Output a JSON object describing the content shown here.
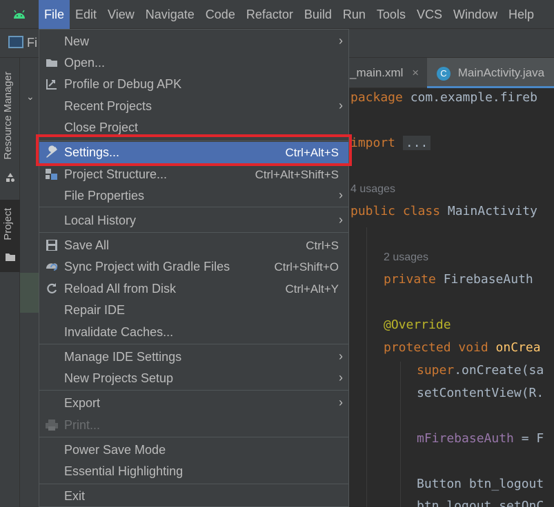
{
  "menubar": {
    "items": [
      "File",
      "Edit",
      "View",
      "Navigate",
      "Code",
      "Refactor",
      "Build",
      "Run",
      "Tools",
      "VCS",
      "Window",
      "Help"
    ]
  },
  "toolbar": {
    "project_text": "Fi"
  },
  "side_strip": {
    "resource_manager": "Resource Manager",
    "project": "Project"
  },
  "editor": {
    "tabs": [
      "_main.xml",
      "MainActivity.java"
    ],
    "usages_4": "4 usages",
    "usages_2": "2 usages",
    "fold_placeholder": "...",
    "code": {
      "line1_kw": "package",
      "line1_rest": " com.example.fireb",
      "import_kw": "import",
      "class_kw": "public class",
      "class_rest": " MainActivity",
      "private_kw": "private",
      "private_rest": " FirebaseAuth",
      "override": "@Override",
      "protected_kw": "protected void",
      "oncreate_fn": " onCrea",
      "super_kw": "super",
      "super_rest": ".onCreate(sa",
      "setcontent": "setContentView(R.",
      "mfirebase_fld": "mFirebaseAuth",
      "mfirebase_rest": " = F",
      "button_line": "Button btn_logout",
      "btn_line2": "btn_logout.setOnC"
    }
  },
  "file_menu": {
    "items": [
      {
        "label": "New",
        "shortcut": "",
        "arrow": true,
        "icon": ""
      },
      {
        "label": "Open...",
        "shortcut": "",
        "arrow": false,
        "icon": "folder-icon"
      },
      {
        "label": "Profile or Debug APK",
        "shortcut": "",
        "arrow": false,
        "icon": "profile-apk-icon"
      },
      {
        "label": "Recent Projects",
        "shortcut": "",
        "arrow": true,
        "icon": ""
      },
      {
        "label": "Close Project",
        "shortcut": "",
        "arrow": false,
        "icon": ""
      },
      {
        "label": "Settings...",
        "shortcut": "Ctrl+Alt+S",
        "arrow": false,
        "icon": "wrench-icon",
        "selected": true
      },
      {
        "label": "Project Structure...",
        "shortcut": "Ctrl+Alt+Shift+S",
        "arrow": false,
        "icon": "project-structure-icon"
      },
      {
        "label": "File Properties",
        "shortcut": "",
        "arrow": true,
        "icon": ""
      },
      {
        "label": "Local History",
        "shortcut": "",
        "arrow": true,
        "icon": ""
      },
      {
        "label": "Save All",
        "shortcut": "Ctrl+S",
        "arrow": false,
        "icon": "save-icon"
      },
      {
        "label": "Sync Project with Gradle Files",
        "shortcut": "Ctrl+Shift+O",
        "arrow": false,
        "icon": "gradle-sync-icon"
      },
      {
        "label": "Reload All from Disk",
        "shortcut": "Ctrl+Alt+Y",
        "arrow": false,
        "icon": "reload-icon"
      },
      {
        "label": "Repair IDE",
        "shortcut": "",
        "arrow": false,
        "icon": ""
      },
      {
        "label": "Invalidate Caches...",
        "shortcut": "",
        "arrow": false,
        "icon": ""
      },
      {
        "label": "Manage IDE Settings",
        "shortcut": "",
        "arrow": true,
        "icon": ""
      },
      {
        "label": "New Projects Setup",
        "shortcut": "",
        "arrow": true,
        "icon": ""
      },
      {
        "label": "Export",
        "shortcut": "",
        "arrow": true,
        "icon": ""
      },
      {
        "label": "Print...",
        "shortcut": "",
        "arrow": false,
        "icon": "printer-icon",
        "disabled": true
      },
      {
        "label": "Power Save Mode",
        "shortcut": "",
        "arrow": false,
        "icon": ""
      },
      {
        "label": "Essential Highlighting",
        "shortcut": "",
        "arrow": false,
        "icon": ""
      },
      {
        "label": "Exit",
        "shortcut": "",
        "arrow": false,
        "icon": ""
      }
    ]
  },
  "colors": {
    "menu_bg": "#3c3f41",
    "selection": "#4b6eaf",
    "highlight_border": "#e0262c",
    "editor_bg": "#2b2b2b",
    "keyword": "#cc7832"
  }
}
